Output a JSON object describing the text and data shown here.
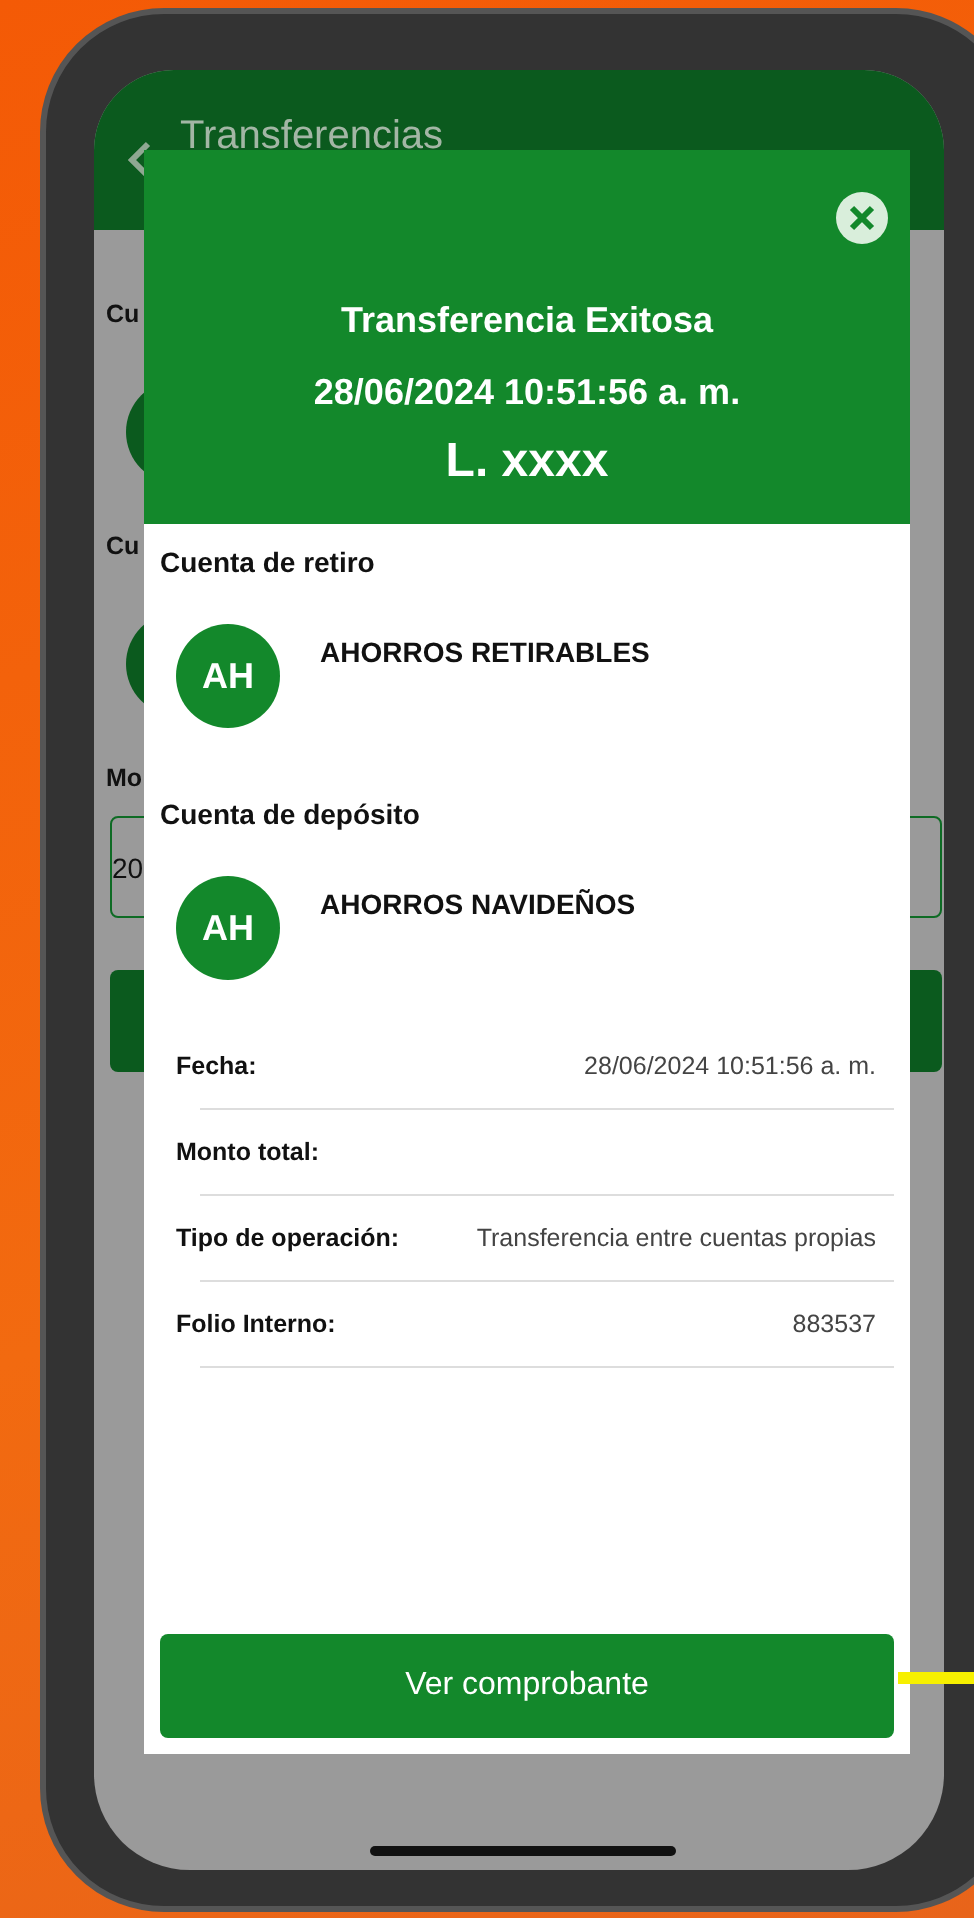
{
  "background_screen": {
    "title": "Transferencias",
    "fields": [
      {
        "label": "Cu",
        "kind": "account"
      },
      {
        "label": "Cu",
        "kind": "account"
      },
      {
        "label": "Mo",
        "kind": "input",
        "value": "20"
      }
    ]
  },
  "dialog": {
    "title": "Transferencia Exitosa",
    "datetime": "28/06/2024 10:51:56 a. m.",
    "amount": "L. xxxx",
    "sections": [
      {
        "heading": "Cuenta de retiro",
        "initials": "AH",
        "name": "AHORROS RETIRABLES"
      },
      {
        "heading": "Cuenta de depósito",
        "initials": "AH",
        "name": "AHORROS NAVIDEÑOS"
      }
    ],
    "details": [
      {
        "label": "Fecha:",
        "value": "28/06/2024 10:51:56 a. m."
      },
      {
        "label": "Monto total:"
      },
      {
        "label": "Tipo de operación:",
        "value": "Transferencia entre cuentas propias"
      },
      {
        "label": "Folio Interno:",
        "value": "883537"
      }
    ],
    "button": "Ver comprobante"
  }
}
